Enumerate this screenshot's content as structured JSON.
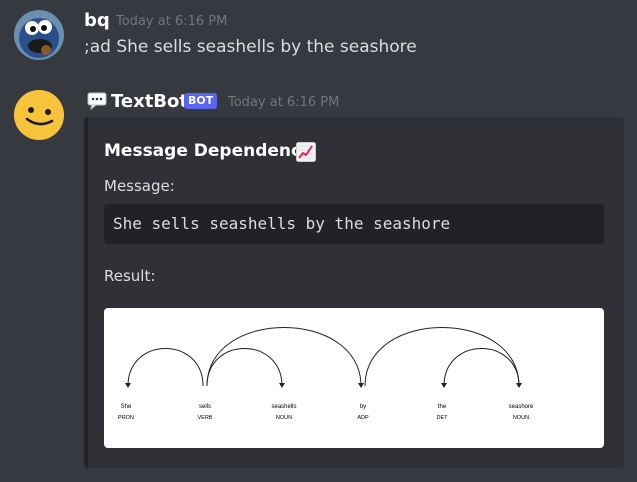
{
  "messages": [
    {
      "author": "bq",
      "timestamp": "Today at 6:16 PM",
      "content": ";ad She sells seashells by the seashore"
    },
    {
      "author": "TextBot",
      "badge": "BOT",
      "timestamp": "Today at 6:16 PM",
      "embed": {
        "title": "Message Dependency",
        "title_icon": "chart-increasing-icon",
        "message_label": "Message:",
        "message_code": "She sells seashells by the seashore",
        "result_label": "Result:",
        "dependency": {
          "tokens": [
            {
              "word": "She",
              "pos": "PRON"
            },
            {
              "word": "sells",
              "pos": "VERB"
            },
            {
              "word": "seashells",
              "pos": "NOUN"
            },
            {
              "word": "by",
              "pos": "ADP"
            },
            {
              "word": "the",
              "pos": "DET"
            },
            {
              "word": "seashore",
              "pos": "NOUN"
            }
          ],
          "arcs": [
            {
              "head": 1,
              "dep": 0
            },
            {
              "head": 1,
              "dep": 2
            },
            {
              "head": 1,
              "dep": 3
            },
            {
              "head": 3,
              "dep": 5
            },
            {
              "head": 5,
              "dep": 4
            }
          ]
        }
      }
    }
  ],
  "colors": {
    "background": "#36393f",
    "embed_background": "#2f3136",
    "badge": "#5865f2",
    "timestamp": "#72767d",
    "avatar_bot": "#f7c33b"
  }
}
